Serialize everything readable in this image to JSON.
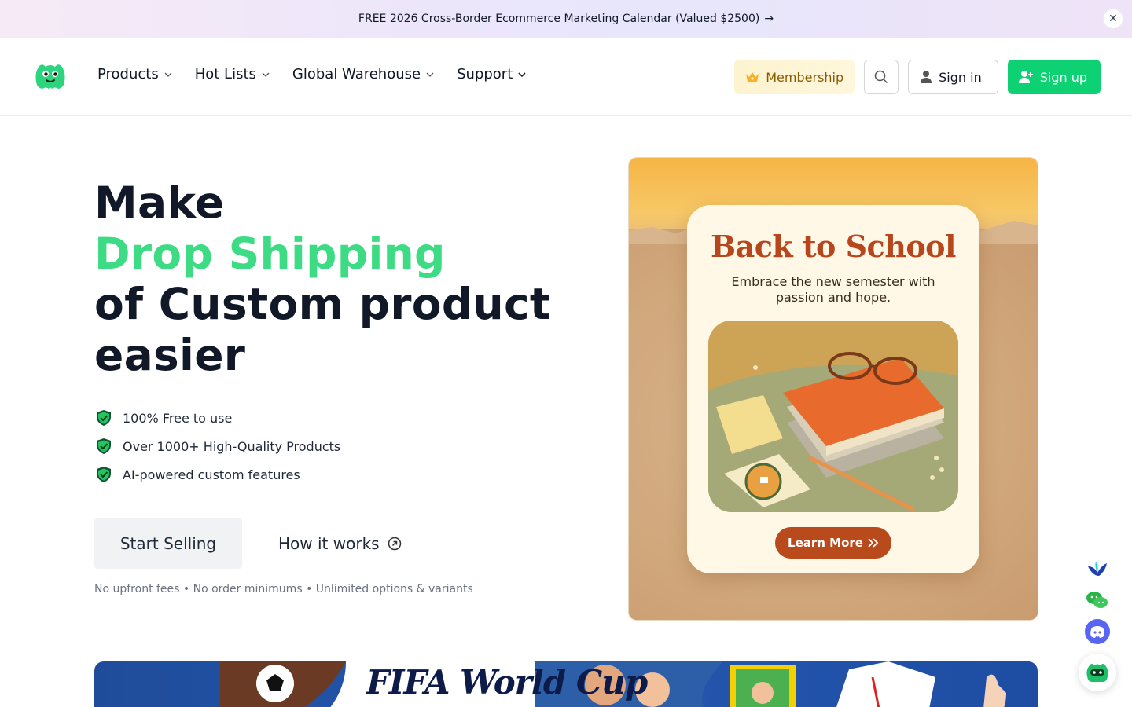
{
  "announcement": {
    "text": "FREE 2026 Cross-Border Ecommerce Marketing Calendar (Valued $2500)",
    "arrow": "→",
    "close": "✕"
  },
  "nav": {
    "items": [
      {
        "label": "Products"
      },
      {
        "label": "Hot Lists"
      },
      {
        "label": "Global Warehouse"
      },
      {
        "label": "Support"
      }
    ],
    "membership": "Membership",
    "sign_in": "Sign in",
    "sign_up": "Sign up"
  },
  "hero": {
    "line1": "Make",
    "line2": "Drop Shipping",
    "line3": "of Custom product",
    "line4": "easier",
    "features": [
      "100% Free to use",
      "Over 1000+ High-Quality Products",
      "AI-powered custom features"
    ],
    "start_selling": "Start Selling",
    "how_it_works": "How it works",
    "note": "No upfront fees • No order minimums • Unlimited options & variants"
  },
  "promo": {
    "title": "Back to School",
    "subtitle": "Embrace the new semester with passion and hope.",
    "button": "Learn More"
  },
  "banner": {
    "text": "FIFA World Cup"
  },
  "colors": {
    "accent_green": "#3ddc84",
    "signup_green": "#0ed173",
    "promo_orange": "#b8461c",
    "banner_blue": "#2558b0"
  },
  "icons": [
    "logo-mascot",
    "chevron-down-icon",
    "crown-icon",
    "search-icon",
    "user-icon",
    "user-plus-icon",
    "shield-check-icon",
    "arrow-up-right-circle-icon",
    "double-chevron-right-icon",
    "close-icon",
    "arrow-right-icon",
    "bird-icon",
    "wechat-icon",
    "discord-icon",
    "chatbot-icon"
  ]
}
